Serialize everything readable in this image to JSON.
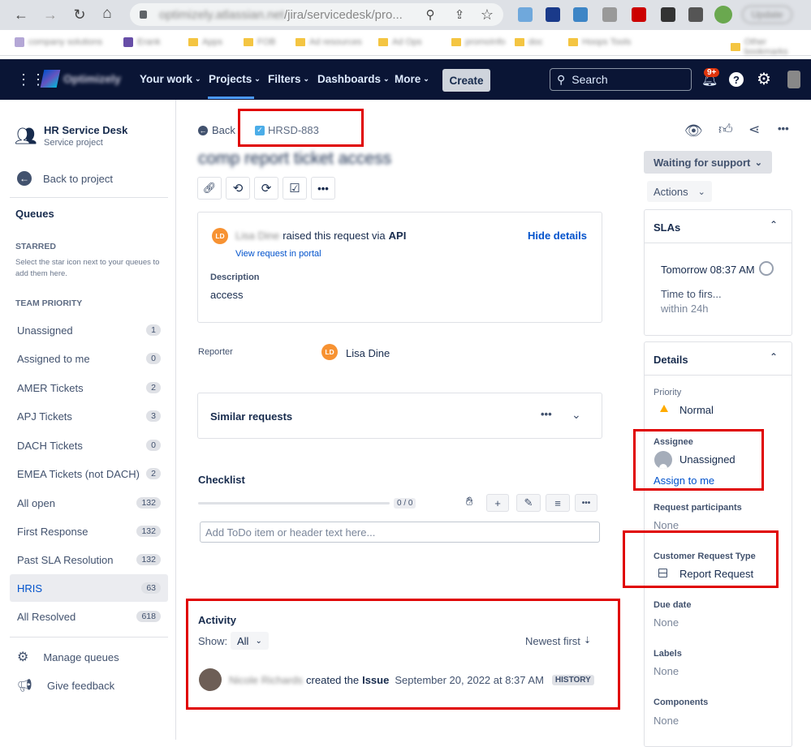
{
  "browser": {
    "url_host": "optimizely.atlassian.net",
    "url_path": "/jira/servicedesk/pro...",
    "update_label": "Update",
    "bookmarks": [
      "company solutions",
      "Erank",
      "Apps",
      "FOB",
      "Ad resources",
      "Ad Ops",
      "promoInfo",
      "doc",
      "Hoops Tools",
      "Other bookmarks"
    ]
  },
  "topnav": {
    "logo": "Optimizely",
    "items": [
      "Your work",
      "Projects",
      "Filters",
      "Dashboards",
      "More"
    ],
    "create_label": "Create",
    "search_placeholder": "Search",
    "notif_count": "9+"
  },
  "sidebar": {
    "project_name": "HR Service Desk",
    "project_type": "Service project",
    "back_label": "Back to project",
    "queues_heading": "Queues",
    "starred_heading": "STARRED",
    "starred_hint": "Select the star icon next to your queues to add them here.",
    "team_heading": "TEAM PRIORITY",
    "queues": [
      {
        "label": "Unassigned",
        "count": "1"
      },
      {
        "label": "Assigned to me",
        "count": "0"
      },
      {
        "label": "AMER Tickets",
        "count": "2"
      },
      {
        "label": "APJ Tickets",
        "count": "3"
      },
      {
        "label": "DACH Tickets",
        "count": "0"
      },
      {
        "label": "EMEA Tickets (not DACH)",
        "count": "2"
      },
      {
        "label": "All open",
        "count": "132"
      },
      {
        "label": "First Response",
        "count": "132"
      },
      {
        "label": "Past SLA Resolution",
        "count": "132"
      },
      {
        "label": "HRIS",
        "count": "63"
      },
      {
        "label": "All Resolved",
        "count": "618"
      }
    ],
    "manage_label": "Manage queues",
    "feedback_label": "Give feedback"
  },
  "issue": {
    "back_label": "Back",
    "key": "HRSD-883",
    "title": "comp report ticket access",
    "requester_initials": "LD",
    "requester_blurred": "Lisa Dine",
    "raised_text": "raised this request via",
    "raised_via": "API",
    "view_portal": "View request in portal",
    "hide_details": "Hide details",
    "description_label": "Description",
    "description": "access",
    "reporter_label": "Reporter",
    "reporter_initials": "LD",
    "reporter_name": "Lisa Dine",
    "similar_label": "Similar requests",
    "checklist_label": "Checklist",
    "checklist_progress": "0 / 0",
    "todo_placeholder": "Add ToDo item or header text here...",
    "activity_label": "Activity",
    "show_label": "Show:",
    "show_value": "All",
    "sort_label": "Newest first",
    "activity_user_blurred": "Nicole Richards",
    "activity_text": "created the",
    "activity_object": "Issue",
    "activity_date": "September 20, 2022 at 8:37 AM",
    "history_badge": "HISTORY"
  },
  "right": {
    "status": "Waiting for support",
    "actions": "Actions",
    "slas_heading": "SLAs",
    "sla_time": "Tomorrow 08:37 AM",
    "sla_name": "Time to firs...",
    "sla_within": "within 24h",
    "details_heading": "Details",
    "priority_label": "Priority",
    "priority_value": "Normal",
    "assignee_label": "Assignee",
    "assignee_value": "Unassigned",
    "assign_to_me": "Assign to me",
    "participants_label": "Request participants",
    "participants_value": "None",
    "crt_label": "Customer Request Type",
    "crt_value": "Report Request",
    "due_label": "Due date",
    "due_value": "None",
    "labels_label": "Labels",
    "labels_value": "None",
    "components_label": "Components",
    "components_value": "None"
  },
  "colors": {
    "nav_bg": "#0a1535",
    "link": "#0052cc",
    "highlight": "#e00000",
    "avatar": "#f79232",
    "notif": "#de350b"
  }
}
